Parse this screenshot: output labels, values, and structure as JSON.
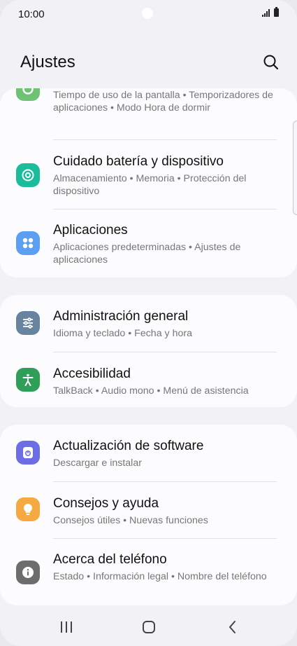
{
  "status_bar": {
    "time": "10:00"
  },
  "header": {
    "title": "Ajustes"
  },
  "settings": {
    "digital": {
      "subtitle": "Tiempo de uso de la pantalla  •  Temporizadores de aplicaciones  •  Modo Hora de dormir",
      "icon": "digital-wellbeing-icon",
      "color": "#6fc274"
    },
    "battery": {
      "title": "Cuidado batería y dispositivo",
      "subtitle": "Almacenamiento  •  Memoria  •  Protección del dispositivo",
      "icon": "device-care-icon",
      "color": "#1bbc9b"
    },
    "apps": {
      "title": "Aplicaciones",
      "subtitle": "Aplicaciones predeterminadas  •  Ajustes de aplicaciones",
      "icon": "apps-icon",
      "color": "#5b9ff2"
    },
    "general": {
      "title": "Administración general",
      "subtitle": "Idioma y teclado  •  Fecha y hora",
      "icon": "sliders-icon",
      "color": "#6783a0"
    },
    "accessibility": {
      "title": "Accesibilidad",
      "subtitle": "TalkBack  •  Audio mono  •  Menú de asistencia",
      "icon": "accessibility-icon",
      "color": "#2f9e58"
    },
    "software": {
      "title": "Actualización de software",
      "subtitle": "Descargar e instalar",
      "icon": "software-update-icon",
      "color": "#6d6ee6"
    },
    "tips": {
      "title": "Consejos y ayuda",
      "subtitle": "Consejos útiles  •  Nuevas funciones",
      "icon": "lightbulb-icon",
      "color": "#f5a940"
    },
    "about": {
      "title": "Acerca del teléfono",
      "subtitle": "Estado  •  Información legal  •  Nombre del teléfono",
      "icon": "info-icon",
      "color": "#6d6d6d"
    }
  },
  "nav_bar": {
    "recents": "recents-icon",
    "home": "home-icon",
    "back": "back-icon"
  }
}
